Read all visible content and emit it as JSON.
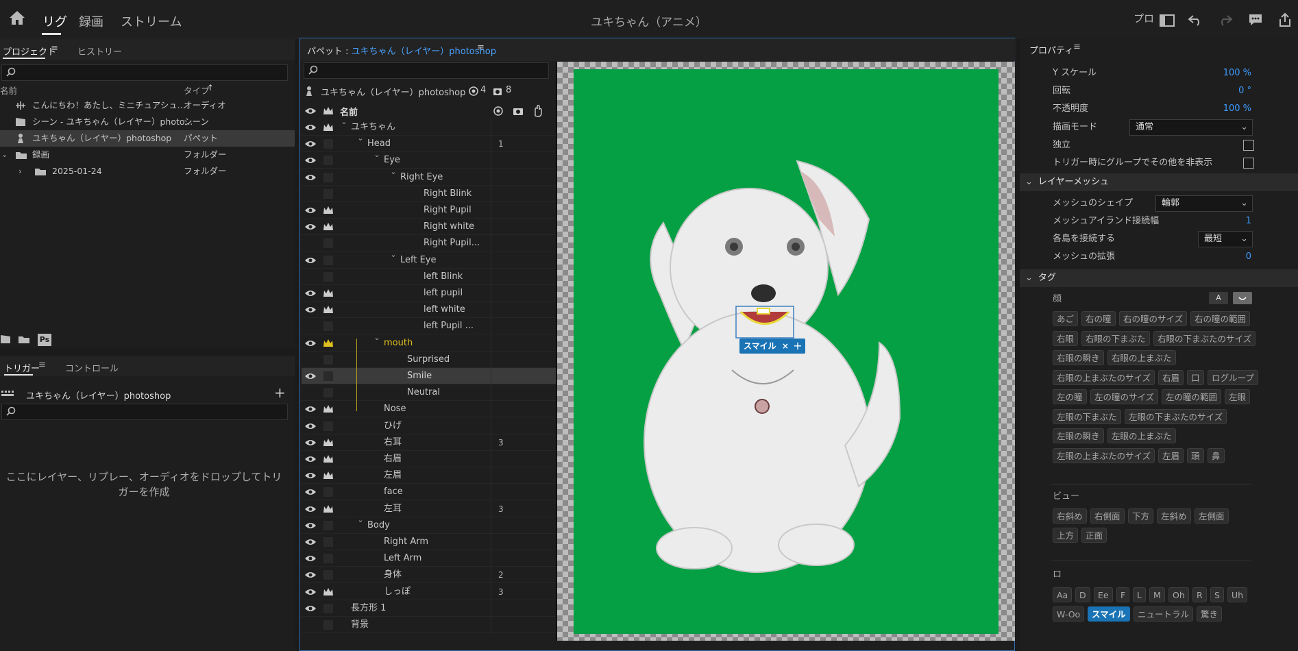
{
  "topbar": {
    "tabs": [
      "リグ",
      "録画",
      "ストリーム"
    ],
    "title": "ユキちゃん（アニメ）",
    "right_label": "プロ"
  },
  "project_panel": {
    "tabs": [
      "プロジェクト",
      "ヒストリー"
    ],
    "columns": {
      "name": "名前",
      "type": "タイプ"
    },
    "items": [
      {
        "name": "こんにちわ！あたし、ミニチュアシュ...",
        "type": "オーディオ",
        "icon": "audio-wave-icon"
      },
      {
        "name": "シーン - ユキちゃん（レイヤー）photo...",
        "type": "シーン",
        "icon": "clapper-icon"
      },
      {
        "name": "ユキちゃん（レイヤー）photoshop",
        "type": "パペット",
        "icon": "puppet-icon",
        "selected": true
      },
      {
        "name": "録画",
        "type": "フォルダー",
        "icon": "folder-icon"
      },
      {
        "name": "2025-01-24",
        "type": "フォルダー",
        "icon": "folder-icon"
      }
    ],
    "bottom_icons": [
      "clapper-icon",
      "folder-icon",
      "photoshop-icon"
    ],
    "ps_label": "Ps"
  },
  "trigger_panel": {
    "tabs": [
      "トリガー",
      "コントロール"
    ],
    "puppet": "ユキちゃん（レイヤー）photoshop",
    "drop_hint_1": "ここにレイヤー、リプレー、オーディオをドロップしてトリ",
    "drop_hint_2": "ガーを作成"
  },
  "puppet_panel": {
    "title_prefix": "パペット : ",
    "title_name": "ユキちゃん（レイヤー）photoshop",
    "puppet_row": {
      "name": "ユキちゃん（レイヤー）photoshop",
      "count_a": "4",
      "count_b": "8"
    },
    "name_header": "名前",
    "layers": [
      {
        "name": "ユキちゃん",
        "num": "",
        "eye": true,
        "crown": true,
        "indent": 0,
        "chev": true
      },
      {
        "name": "Head",
        "num": "1",
        "eye": true,
        "crown": false,
        "indent": 1,
        "chev": true
      },
      {
        "name": "Eye",
        "num": "",
        "eye": true,
        "crown": false,
        "indent": 2,
        "chev": true
      },
      {
        "name": "Right Eye",
        "num": "",
        "eye": true,
        "crown": false,
        "indent": 3,
        "chev": true
      },
      {
        "name": "Right Blink",
        "num": "",
        "eye": false,
        "crown": false,
        "indent": 4,
        "chev": false
      },
      {
        "name": "Right Pupil",
        "num": "",
        "eye": true,
        "crown": true,
        "indent": 4,
        "chev": false
      },
      {
        "name": "Right white",
        "num": "",
        "eye": true,
        "crown": true,
        "indent": 4,
        "chev": false
      },
      {
        "name": "Right Pupil...",
        "num": "",
        "eye": false,
        "crown": false,
        "indent": 4,
        "chev": false
      },
      {
        "name": "Left Eye",
        "num": "",
        "eye": true,
        "crown": false,
        "indent": 3,
        "chev": true
      },
      {
        "name": "left Blink",
        "num": "",
        "eye": false,
        "crown": false,
        "indent": 4,
        "chev": false
      },
      {
        "name": "left pupil",
        "num": "",
        "eye": true,
        "crown": true,
        "indent": 4,
        "chev": false
      },
      {
        "name": "left white",
        "num": "",
        "eye": true,
        "crown": true,
        "indent": 4,
        "chev": false
      },
      {
        "name": "left Pupil ...",
        "num": "",
        "eye": false,
        "crown": false,
        "indent": 4,
        "chev": false
      },
      {
        "name": "mouth",
        "num": "",
        "eye": true,
        "crown": true,
        "indent": 2,
        "chev": true,
        "highlight": true
      },
      {
        "name": "Surprised",
        "num": "",
        "eye": false,
        "crown": false,
        "indent": 3,
        "chev": false
      },
      {
        "name": "Smile",
        "num": "",
        "eye": true,
        "crown": false,
        "indent": 3,
        "chev": false,
        "selected": true
      },
      {
        "name": "Neutral",
        "num": "",
        "eye": false,
        "crown": false,
        "indent": 3,
        "chev": false
      },
      {
        "name": "Nose",
        "num": "",
        "eye": true,
        "crown": true,
        "indent": 2,
        "chev": false
      },
      {
        "name": "ひげ",
        "num": "",
        "eye": true,
        "crown": false,
        "indent": 2,
        "chev": false
      },
      {
        "name": "右耳",
        "num": "3",
        "eye": true,
        "crown": true,
        "indent": 2,
        "chev": false
      },
      {
        "name": "右眉",
        "num": "",
        "eye": true,
        "crown": true,
        "indent": 2,
        "chev": false
      },
      {
        "name": "左眉",
        "num": "",
        "eye": true,
        "crown": true,
        "indent": 2,
        "chev": false
      },
      {
        "name": "face",
        "num": "",
        "eye": true,
        "crown": false,
        "indent": 2,
        "chev": false
      },
      {
        "name": "左耳",
        "num": "3",
        "eye": true,
        "crown": true,
        "indent": 2,
        "chev": false
      },
      {
        "name": "Body",
        "num": "",
        "eye": true,
        "crown": false,
        "indent": 1,
        "chev": true
      },
      {
        "name": "Right Arm",
        "num": "",
        "eye": true,
        "crown": false,
        "indent": 2,
        "chev": false
      },
      {
        "name": "Left Arm",
        "num": "",
        "eye": true,
        "crown": false,
        "indent": 2,
        "chev": false
      },
      {
        "name": "身体",
        "num": "2",
        "eye": true,
        "crown": false,
        "indent": 2,
        "chev": false
      },
      {
        "name": "しっぽ",
        "num": "3",
        "eye": true,
        "crown": true,
        "indent": 2,
        "chev": false
      },
      {
        "name": "長方形 1",
        "num": "",
        "eye": true,
        "crown": false,
        "indent": 0,
        "chev": false
      },
      {
        "name": "背景",
        "num": "",
        "eye": false,
        "crown": false,
        "indent": 0,
        "chev": false
      }
    ]
  },
  "canvas": {
    "tag_chip": "スマイル",
    "canvas_color": "#04a043"
  },
  "properties": {
    "title": "プロパティ",
    "rows": [
      {
        "label": "Y スケール",
        "value": "100 %"
      },
      {
        "label": "回転",
        "value": "0 °"
      },
      {
        "label": "不透明度",
        "value": "100 %"
      }
    ],
    "blend_label": "描画モード",
    "blend_value": "通常",
    "independent_label": "独立",
    "hide_others_label": "トリガー時にグループでその他を非表示",
    "mesh_section": "レイヤーメッシュ",
    "mesh_shape_label": "メッシュのシェイプ",
    "mesh_shape_value": "輪郭",
    "island_label": "メッシュアイランド接続幅",
    "island_value": "1",
    "connect_label": "各島を接続する",
    "connect_value": "最短",
    "expand_label": "メッシュの拡張",
    "expand_value": "0",
    "tag_section": "タグ",
    "face_group": "顔",
    "face_tags": [
      [
        "あご",
        "右の瞳",
        "右の瞳のサイズ",
        "右の瞳の範囲"
      ],
      [
        "右眼",
        "右眼の下まぶた",
        "右眼の下まぶたのサイズ"
      ],
      [
        "右眼の瞬き",
        "右眼の上まぶた"
      ],
      [
        "右眼の上まぶたのサイズ",
        "右眉",
        "口",
        "ログループ"
      ],
      [
        "左の瞳",
        "左の瞳のサイズ",
        "左の瞳の範囲",
        "左眼"
      ],
      [
        "左眼の下まぶた",
        "左眼の下まぶたのサイズ"
      ],
      [
        "左眼の瞬き",
        "左眼の上まぶた"
      ],
      [
        "左眼の上まぶたのサイズ",
        "左眉",
        "頭",
        "鼻"
      ]
    ],
    "view_group": "ビュー",
    "view_tags": [
      [
        "右斜め",
        "右側面",
        "下方",
        "左斜め",
        "左側面"
      ],
      [
        "上方",
        "正面"
      ]
    ],
    "mouth_group": "ロ",
    "mouth_tags": [
      [
        "Aa",
        "D",
        "Ee",
        "F",
        "L",
        "M",
        "Oh",
        "R",
        "S",
        "Uh"
      ],
      [
        "W-Oo",
        "スマイル",
        "ニュートラル",
        "驚き"
      ]
    ],
    "selected_tag": "スマイル",
    "toggle_a": "A"
  }
}
